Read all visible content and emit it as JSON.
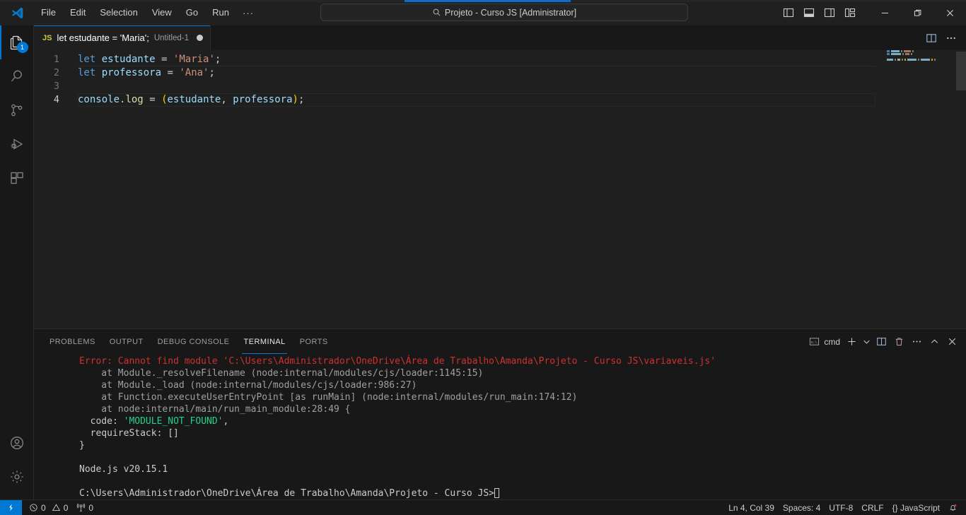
{
  "window": {
    "quick_input_text": "Projeto - Curso JS [Administrator]",
    "menu": [
      "File",
      "Edit",
      "Selection",
      "View",
      "Go",
      "Run"
    ],
    "menu_overflow": "···",
    "nav_back": "←",
    "nav_forward": "→",
    "layout_icons": [
      "toggle-primary-sidebar",
      "toggle-panel",
      "toggle-secondary-sidebar",
      "customize-layout"
    ],
    "controls": [
      "minimize",
      "maximize",
      "close"
    ]
  },
  "activitybar": {
    "items": [
      {
        "name": "explorer",
        "badge": "1",
        "active": true
      },
      {
        "name": "search",
        "badge": "",
        "active": false
      },
      {
        "name": "source-control",
        "badge": "",
        "active": false
      },
      {
        "name": "run-and-debug",
        "badge": "",
        "active": false
      },
      {
        "name": "extensions",
        "badge": "",
        "active": false
      }
    ],
    "bottom": [
      {
        "name": "accounts"
      },
      {
        "name": "manage-settings"
      }
    ]
  },
  "editor": {
    "tab": {
      "file_type": "JS",
      "label": "let estudante = 'Maria';",
      "description": "Untitled-1",
      "dirty": true
    },
    "actions": [
      "split-editor-right",
      "more-actions"
    ],
    "lines": [
      {
        "number": "1",
        "tokens": [
          {
            "t": "let",
            "c": "t-key"
          },
          {
            "t": " ",
            "c": "t-punc"
          },
          {
            "t": "estudante",
            "c": "t-var"
          },
          {
            "t": " ",
            "c": "t-punc"
          },
          {
            "t": "=",
            "c": "t-punc"
          },
          {
            "t": " ",
            "c": "t-punc"
          },
          {
            "t": "'Maria'",
            "c": "t-str"
          },
          {
            "t": ";",
            "c": "t-punc"
          }
        ]
      },
      {
        "number": "2",
        "tokens": [
          {
            "t": "let",
            "c": "t-key"
          },
          {
            "t": " ",
            "c": "t-punc"
          },
          {
            "t": "professora",
            "c": "t-var"
          },
          {
            "t": " ",
            "c": "t-punc"
          },
          {
            "t": "=",
            "c": "t-punc"
          },
          {
            "t": " ",
            "c": "t-punc"
          },
          {
            "t": "'Ana'",
            "c": "t-str"
          },
          {
            "t": ";",
            "c": "t-punc"
          }
        ]
      },
      {
        "number": "3",
        "tokens": []
      },
      {
        "number": "4",
        "current": true,
        "tokens": [
          {
            "t": "console",
            "c": "t-var"
          },
          {
            "t": ".",
            "c": "t-punc"
          },
          {
            "t": "log",
            "c": "t-fn"
          },
          {
            "t": " ",
            "c": "t-punc"
          },
          {
            "t": "=",
            "c": "t-punc"
          },
          {
            "t": " ",
            "c": "t-punc"
          },
          {
            "t": "(",
            "c": "t-paren"
          },
          {
            "t": "estudante",
            "c": "t-var"
          },
          {
            "t": ",",
            "c": "t-punc"
          },
          {
            "t": " ",
            "c": "t-punc"
          },
          {
            "t": "professora",
            "c": "t-var"
          },
          {
            "t": ")",
            "c": "t-paren"
          },
          {
            "t": ";",
            "c": "t-punc"
          }
        ]
      }
    ]
  },
  "panel": {
    "tabs": [
      {
        "label": "PROBLEMS",
        "active": false
      },
      {
        "label": "OUTPUT",
        "active": false
      },
      {
        "label": "DEBUG CONSOLE",
        "active": false
      },
      {
        "label": "TERMINAL",
        "active": true
      },
      {
        "label": "PORTS",
        "active": false
      }
    ],
    "terminal_name": "cmd",
    "actions": [
      "new-terminal",
      "terminal-profile-dropdown",
      "split-terminal",
      "kill-terminal",
      "views-and-more-actions",
      "hide-panel",
      "close-panel"
    ],
    "terminal_lines": [
      {
        "segs": [
          {
            "t": "Error: Cannot find module 'C:\\Users\\Administrador\\OneDrive\\Área de Trabalho\\Amanda\\Projeto - Curso JS\\variaveis.js'",
            "c": "c-err"
          }
        ]
      },
      {
        "segs": [
          {
            "t": "    at Module._resolveFilename (node:internal/modules/cjs/loader:1145:15)",
            "c": "c-dim"
          }
        ]
      },
      {
        "segs": [
          {
            "t": "    at Module._load (node:internal/modules/cjs/loader:986:27)",
            "c": "c-dim"
          }
        ]
      },
      {
        "segs": [
          {
            "t": "    at Function.executeUserEntryPoint [as runMain] (node:internal/modules/run_main:174:12)",
            "c": "c-dim"
          }
        ]
      },
      {
        "segs": [
          {
            "t": "    at node:internal/main/run_main_module:28:49 {",
            "c": "c-dim"
          }
        ]
      },
      {
        "segs": [
          {
            "t": "  code: ",
            "c": ""
          },
          {
            "t": "'MODULE_NOT_FOUND'",
            "c": "c-grn"
          },
          {
            "t": ",",
            "c": ""
          }
        ]
      },
      {
        "segs": [
          {
            "t": "  requireStack: []",
            "c": ""
          }
        ]
      },
      {
        "segs": [
          {
            "t": "}",
            "c": ""
          }
        ]
      },
      {
        "segs": [
          {
            "t": " ",
            "c": ""
          }
        ]
      },
      {
        "segs": [
          {
            "t": "Node.js v20.15.1",
            "c": ""
          }
        ]
      },
      {
        "segs": [
          {
            "t": " ",
            "c": ""
          }
        ]
      },
      {
        "segs": [
          {
            "t": "C:\\Users\\Administrador\\OneDrive\\Área de Trabalho\\Amanda\\Projeto - Curso JS>",
            "c": ""
          }
        ],
        "cursor": true
      }
    ]
  },
  "statusbar": {
    "remote_label": "",
    "errors": "0",
    "warnings": "0",
    "ports": "0",
    "right": [
      {
        "name": "editor-position",
        "label": "Ln 4, Col 39"
      },
      {
        "name": "editor-indentation",
        "label": "Spaces: 4"
      },
      {
        "name": "editor-encoding",
        "label": "UTF-8"
      },
      {
        "name": "editor-eol",
        "label": "CRLF"
      },
      {
        "name": "editor-language",
        "label": "{} JavaScript"
      }
    ]
  },
  "colors": {
    "accent": "#0078d4",
    "error": "#cd3131",
    "green": "#23d18b",
    "titlebar_bg": "#202020",
    "editor_bg": "#1f1f1f",
    "panel_bg": "#181818"
  }
}
